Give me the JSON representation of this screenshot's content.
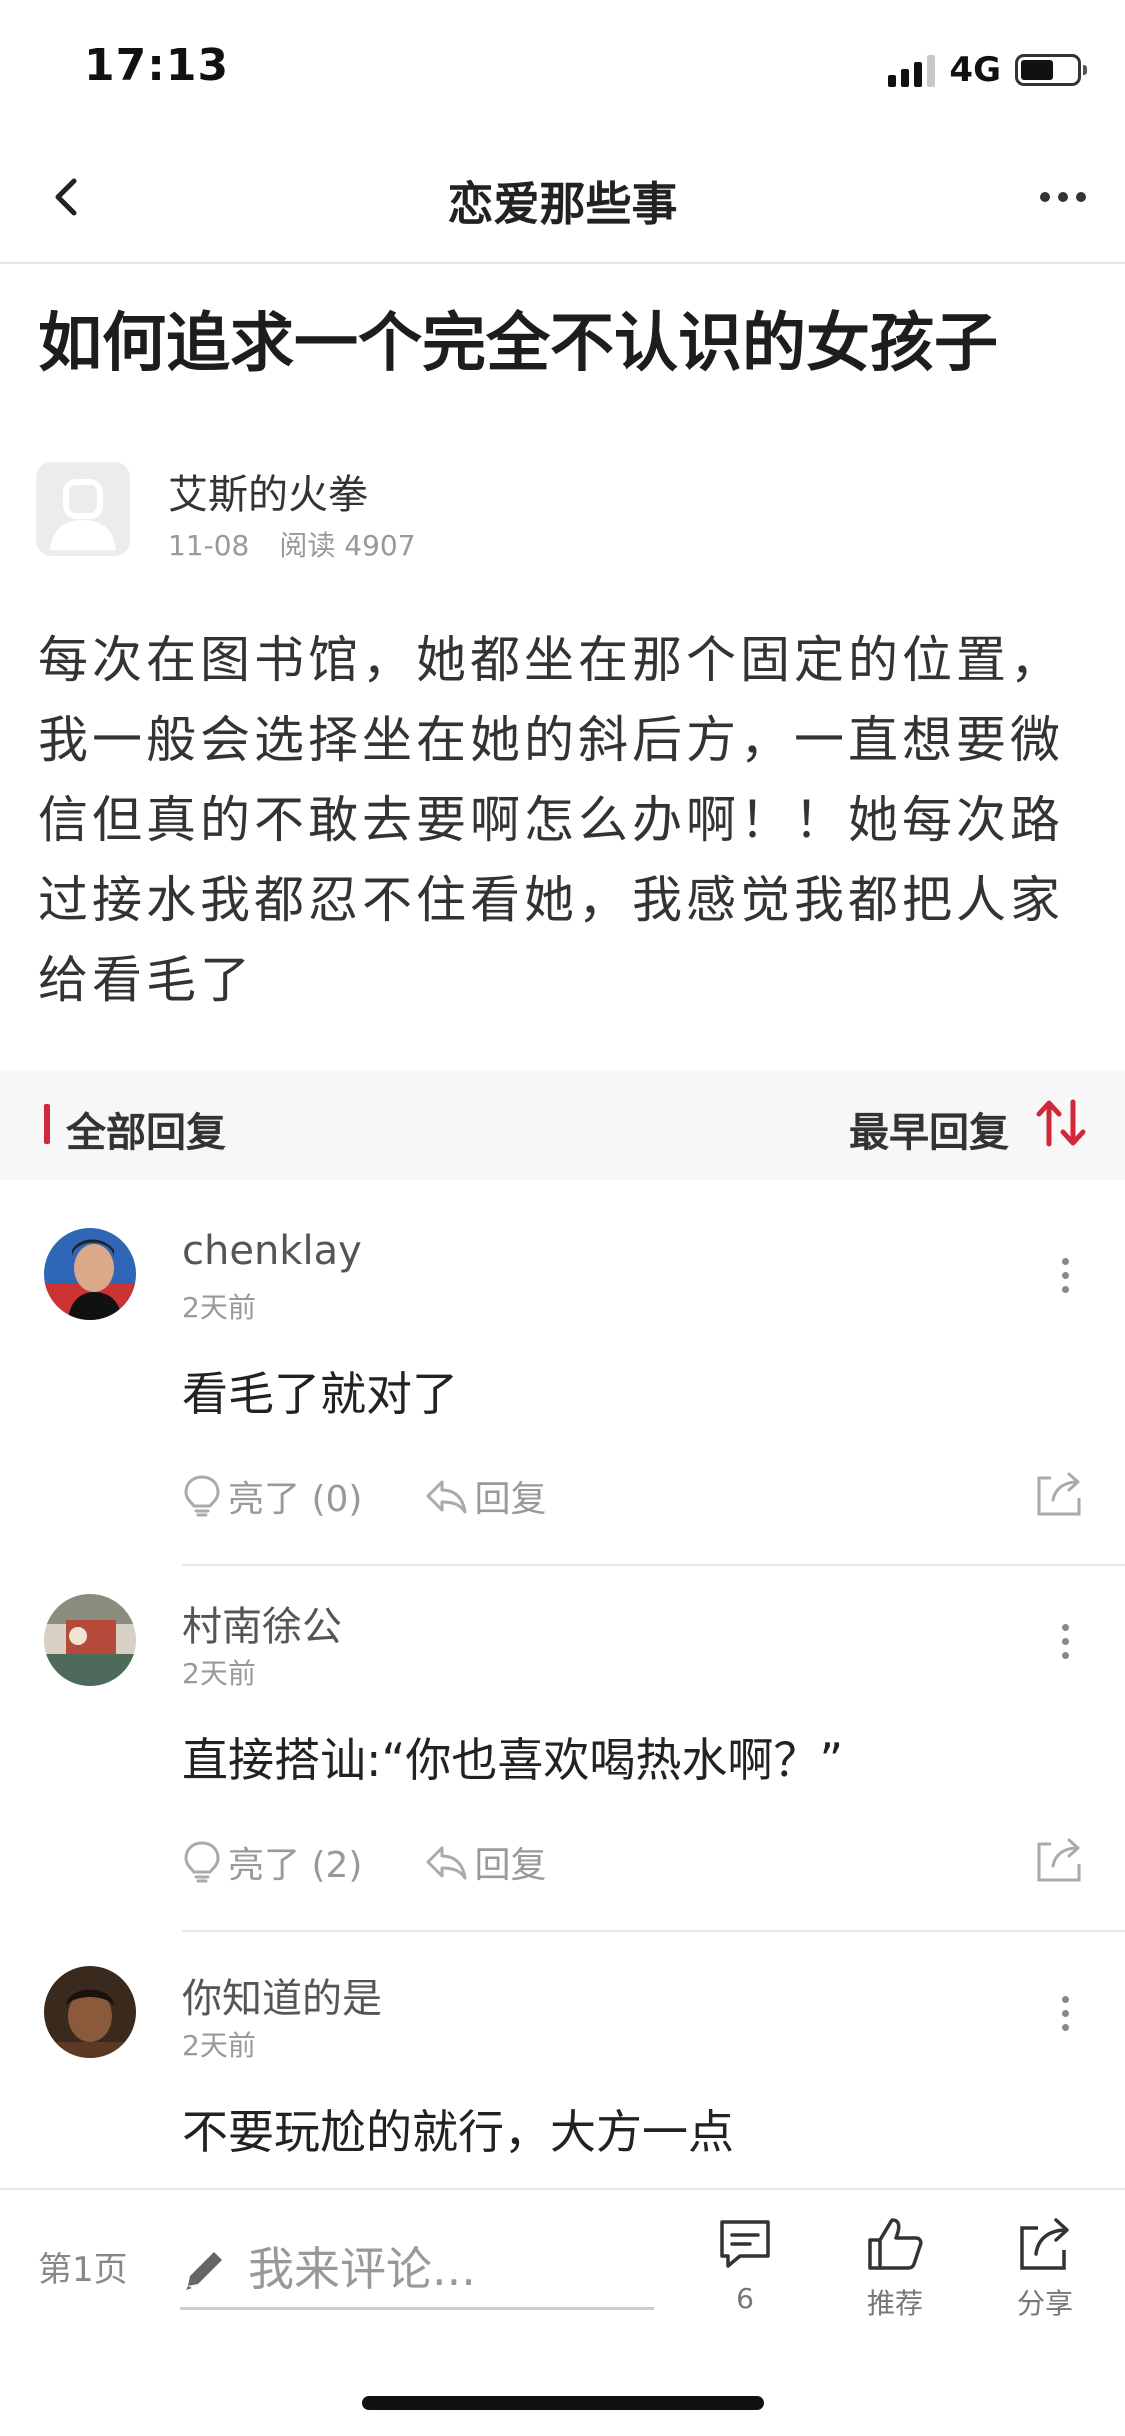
{
  "status_bar": {
    "time": "17:13",
    "network": "4G",
    "battery_level": 0.6
  },
  "nav": {
    "title": "恋爱那些事"
  },
  "post": {
    "title": "如何追求一个完全不认识的女孩子",
    "author": {
      "name": "艾斯的火拳",
      "date": "11-08",
      "reads": "阅读 4907"
    },
    "body": "每次在图书馆，她都坐在那个固定的位置，我一般会选择坐在她的斜后方，一直想要微信但真的不敢去要啊怎么办啊！！她每次路过接水我都忍不住看她，我感觉我都把人家给看毛了"
  },
  "replies": {
    "all_label": "全部回复",
    "sort_label": "最早回复"
  },
  "comments": [
    {
      "name": "chenklay",
      "time": "2天前",
      "text": "看毛了就对了",
      "likes": "亮了 (0)",
      "reply": "回复",
      "avatar_color": "#2f66b8"
    },
    {
      "name": "村南徐公",
      "time": "2天前",
      "text": "直接搭讪:“你也喜欢喝热水啊？”",
      "likes": "亮了 (2)",
      "reply": "回复",
      "avatar_color": "#b64a3a"
    },
    {
      "name": "你知道的是",
      "time": "2天前",
      "text": "不要玩尬的就行，大方一点",
      "likes": "",
      "reply": "",
      "avatar_color": "#5a3a24"
    }
  ],
  "bottom_bar": {
    "page_label": "第1页",
    "comment_placeholder": "我来评论...",
    "comment_count": "6",
    "recommend_label": "推荐",
    "share_label": "分享"
  },
  "colors": {
    "accent": "#d0273a",
    "muted": "#999999"
  }
}
